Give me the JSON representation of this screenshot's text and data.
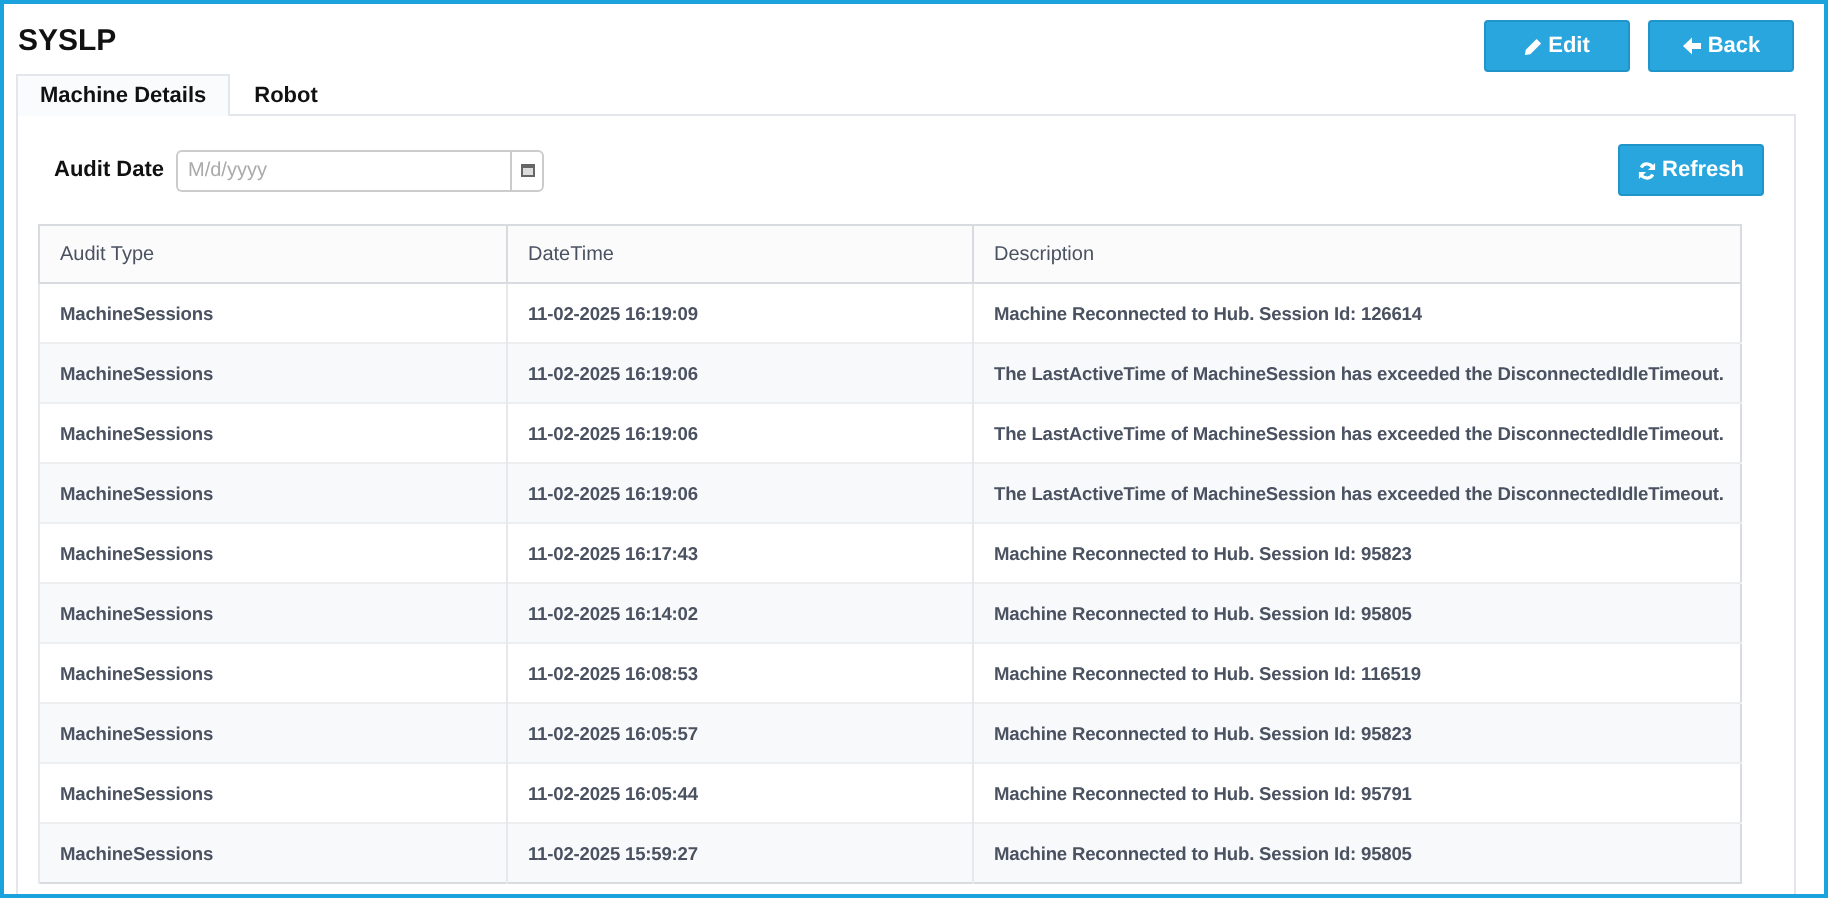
{
  "title": "SYSLP",
  "buttons": [
    {
      "kind": "edit",
      "label": "Edit"
    },
    {
      "kind": "back",
      "label": "Back"
    }
  ],
  "tabs": [
    {
      "label": "Machine Details",
      "selected": true
    },
    {
      "label": "Robot",
      "selected": false
    }
  ],
  "audit_date": {
    "label": "Audit Date",
    "placeholder": "M/d/yyyy"
  },
  "refresh_button": {
    "label": "Refresh"
  },
  "table": {
    "columns": [
      "Audit Type",
      "DateTime",
      "Description"
    ],
    "rows": [
      [
        "MachineSessions",
        "11-02-2025 16:19:09",
        "Machine Reconnected to Hub. Session Id: 126614"
      ],
      [
        "MachineSessions",
        "11-02-2025 16:19:06",
        "The LastActiveTime of MachineSession has exceeded the DisconnectedIdleTimeout."
      ],
      [
        "MachineSessions",
        "11-02-2025 16:19:06",
        "The LastActiveTime of MachineSession has exceeded the DisconnectedIdleTimeout."
      ],
      [
        "MachineSessions",
        "11-02-2025 16:19:06",
        "The LastActiveTime of MachineSession has exceeded the DisconnectedIdleTimeout."
      ],
      [
        "MachineSessions",
        "11-02-2025 16:17:43",
        "Machine Reconnected to Hub. Session Id: 95823"
      ],
      [
        "MachineSessions",
        "11-02-2025 16:14:02",
        "Machine Reconnected to Hub. Session Id: 95805"
      ],
      [
        "MachineSessions",
        "11-02-2025 16:08:53",
        "Machine Reconnected to Hub. Session Id: 116519"
      ],
      [
        "MachineSessions",
        "11-02-2025 16:05:57",
        "Machine Reconnected to Hub. Session Id: 95823"
      ],
      [
        "MachineSessions",
        "11-02-2025 16:05:44",
        "Machine Reconnected to Hub. Session Id: 95791"
      ],
      [
        "MachineSessions",
        "11-02-2025 15:59:27",
        "Machine Reconnected to Hub. Session Id: 95805"
      ]
    ]
  }
}
